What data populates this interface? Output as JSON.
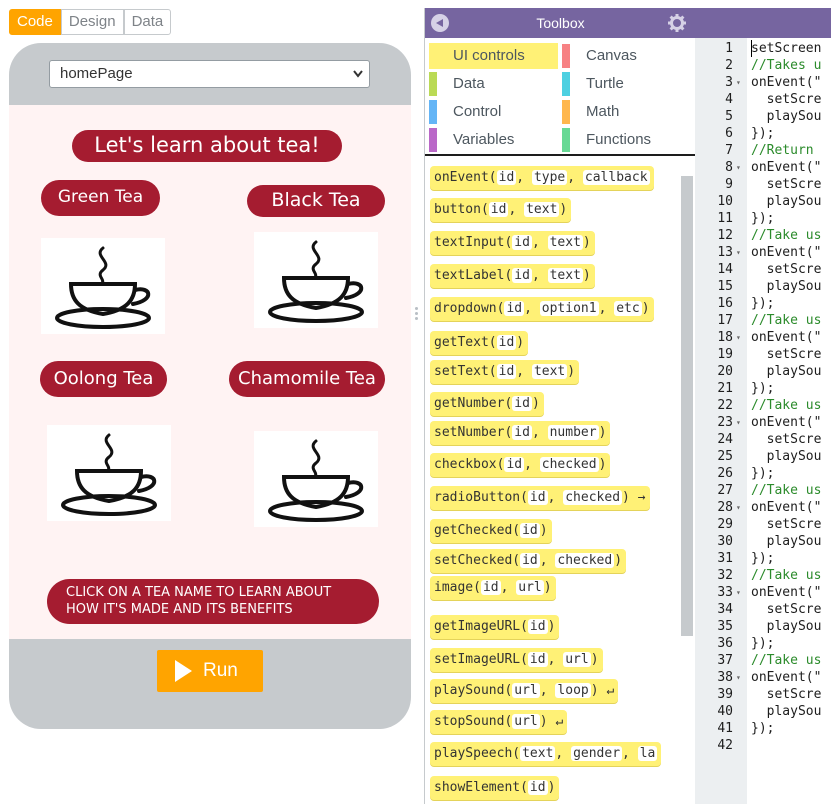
{
  "mode_toggle": {
    "code": "Code",
    "design": "Design",
    "data": "Data"
  },
  "app": {
    "screen_selected": "homePage",
    "title": "Let's learn about tea!",
    "teas": {
      "green": "Green Tea",
      "black": "Black Tea",
      "oolong": "Oolong Tea",
      "chamomile": "Chamomile Tea"
    },
    "instruction_line1": "CLICK ON A TEA NAME TO LEARN ABOUT",
    "instruction_line2": "HOW IT'S MADE AND ITS BENEFITS",
    "run_label": "Run"
  },
  "toolbox": {
    "title": "Toolbox",
    "categories": [
      {
        "label": "UI controls",
        "color": "#fff176"
      },
      {
        "label": "Canvas",
        "color": "#f78183"
      },
      {
        "label": "Data",
        "color": "#bada55"
      },
      {
        "label": "Turtle",
        "color": "#4dd0e1"
      },
      {
        "label": "Control",
        "color": "#64b5f6"
      },
      {
        "label": "Math",
        "color": "#ffb74d"
      },
      {
        "label": "Variables",
        "color": "#ba68c8"
      },
      {
        "label": "Functions",
        "color": "#68d995"
      }
    ],
    "blocks": [
      "onEvent(id, type, callback",
      "button(id, text)",
      "textInput(id, text)",
      "textLabel(id, text)",
      "dropdown(id, option1, etc)",
      "getText(id)",
      "setText(id, text)",
      "getNumber(id)",
      "setNumber(id, number)",
      "checkbox(id, checked)",
      "radioButton(id, checked) →",
      "getChecked(id)",
      "setChecked(id, checked)",
      "image(id, url)",
      "getImageURL(id)",
      "setImageURL(id, url)",
      "playSound(url, loop) ↵",
      "stopSound(url) ↵",
      "playSpeech(text, gender, la",
      "showElement(id)"
    ]
  },
  "editor": {
    "lines": [
      {
        "n": "1",
        "text": "setScreen",
        "type": "code",
        "fold": ""
      },
      {
        "n": "2",
        "text": "//Takes u",
        "type": "comment",
        "fold": ""
      },
      {
        "n": "3",
        "text": "onEvent(\"",
        "type": "code",
        "fold": "▾"
      },
      {
        "n": "4",
        "text": "  setScre",
        "type": "code",
        "fold": ""
      },
      {
        "n": "5",
        "text": "  playSou",
        "type": "code",
        "fold": ""
      },
      {
        "n": "6",
        "text": "});",
        "type": "code",
        "fold": ""
      },
      {
        "n": "7",
        "text": "//Return ",
        "type": "comment",
        "fold": ""
      },
      {
        "n": "8",
        "text": "onEvent(\"",
        "type": "code",
        "fold": "▾"
      },
      {
        "n": "9",
        "text": "  setScre",
        "type": "code",
        "fold": ""
      },
      {
        "n": "10",
        "text": "  playSou",
        "type": "code",
        "fold": ""
      },
      {
        "n": "11",
        "text": "});",
        "type": "code",
        "fold": ""
      },
      {
        "n": "12",
        "text": "//Take us",
        "type": "comment",
        "fold": ""
      },
      {
        "n": "13",
        "text": "onEvent(\"",
        "type": "code",
        "fold": "▾"
      },
      {
        "n": "14",
        "text": "  setScre",
        "type": "code",
        "fold": ""
      },
      {
        "n": "15",
        "text": "  playSou",
        "type": "code",
        "fold": ""
      },
      {
        "n": "16",
        "text": "});",
        "type": "code",
        "fold": ""
      },
      {
        "n": "17",
        "text": "//Take us",
        "type": "comment",
        "fold": ""
      },
      {
        "n": "18",
        "text": "onEvent(\"",
        "type": "code",
        "fold": "▾"
      },
      {
        "n": "19",
        "text": "  setScre",
        "type": "code",
        "fold": ""
      },
      {
        "n": "20",
        "text": "  playSou",
        "type": "code",
        "fold": ""
      },
      {
        "n": "21",
        "text": "});",
        "type": "code",
        "fold": ""
      },
      {
        "n": "22",
        "text": "//Take us",
        "type": "comment",
        "fold": ""
      },
      {
        "n": "23",
        "text": "onEvent(\"",
        "type": "code",
        "fold": "▾"
      },
      {
        "n": "24",
        "text": "  setScre",
        "type": "code",
        "fold": ""
      },
      {
        "n": "25",
        "text": "  playSou",
        "type": "code",
        "fold": ""
      },
      {
        "n": "26",
        "text": "});",
        "type": "code",
        "fold": ""
      },
      {
        "n": "27",
        "text": "//Take us",
        "type": "comment",
        "fold": ""
      },
      {
        "n": "28",
        "text": "onEvent(\"",
        "type": "code",
        "fold": "▾"
      },
      {
        "n": "29",
        "text": "  setScre",
        "type": "code",
        "fold": ""
      },
      {
        "n": "30",
        "text": "  playSou",
        "type": "code",
        "fold": ""
      },
      {
        "n": "31",
        "text": "});",
        "type": "code",
        "fold": ""
      },
      {
        "n": "32",
        "text": "//Take us",
        "type": "comment",
        "fold": ""
      },
      {
        "n": "33",
        "text": "onEvent(\"",
        "type": "code",
        "fold": "▾"
      },
      {
        "n": "34",
        "text": "  setScre",
        "type": "code",
        "fold": ""
      },
      {
        "n": "35",
        "text": "  playSou",
        "type": "code",
        "fold": ""
      },
      {
        "n": "36",
        "text": "});",
        "type": "code",
        "fold": ""
      },
      {
        "n": "37",
        "text": "//Take us",
        "type": "comment",
        "fold": ""
      },
      {
        "n": "38",
        "text": "onEvent(\"",
        "type": "code",
        "fold": "▾"
      },
      {
        "n": "39",
        "text": "  setScre",
        "type": "code",
        "fold": ""
      },
      {
        "n": "40",
        "text": "  playSou",
        "type": "code",
        "fold": ""
      },
      {
        "n": "41",
        "text": "});",
        "type": "code",
        "fold": ""
      },
      {
        "n": "42",
        "text": "",
        "type": "code",
        "fold": ""
      }
    ]
  }
}
